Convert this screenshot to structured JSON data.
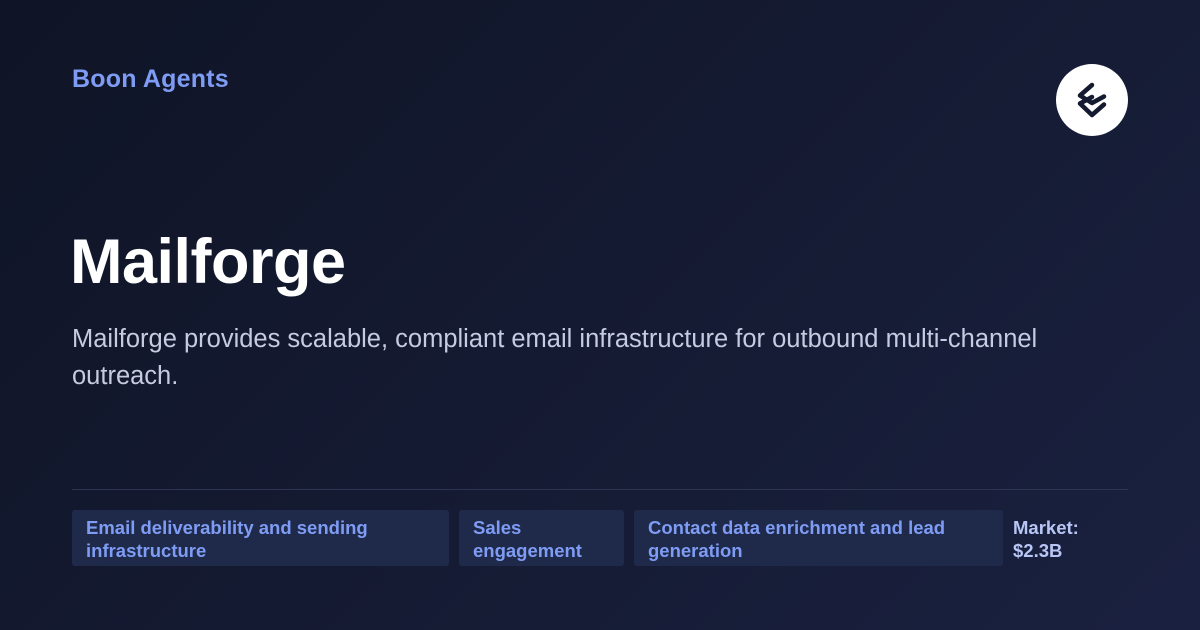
{
  "brand": {
    "name": "Boon Agents",
    "logo_icon": "boon-logo-icon"
  },
  "company": {
    "name": "Mailforge",
    "description": "Mailforge provides scalable, compliant email infrastructure for outbound multi-channel outreach."
  },
  "tags": [
    {
      "label": "Email deliverability and sending infrastructure"
    },
    {
      "label": "Sales engagement"
    },
    {
      "label": "Contact data enrichment and lead generation"
    }
  ],
  "market": {
    "label": "Market:",
    "value": "$2.3B"
  },
  "colors": {
    "background": "#141a30",
    "accent": "#7f9cf5",
    "tag_background": "#1f2a4a",
    "title": "#ffffff",
    "description": "#c5cbe0"
  }
}
